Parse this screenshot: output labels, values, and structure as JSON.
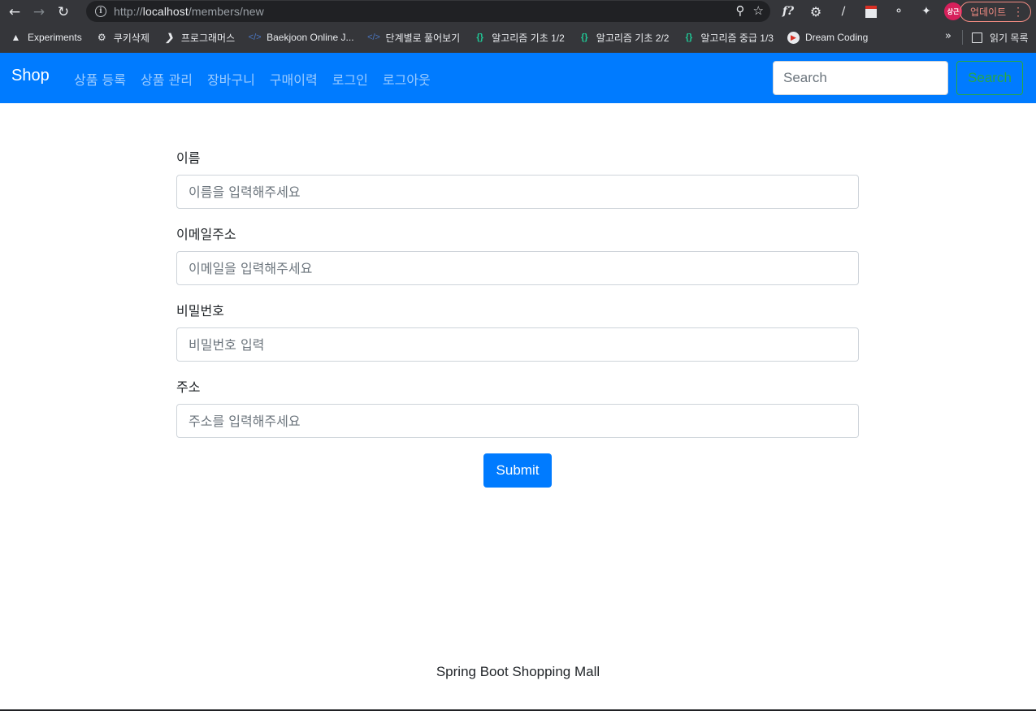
{
  "browser": {
    "url_prefix": "http://",
    "url_host": "localhost",
    "url_path": "/members/new",
    "update_label": "업데이트",
    "avatar_text": "상근",
    "bookmarks": [
      {
        "label": "Experiments",
        "icon": "flask-icon"
      },
      {
        "label": "쿠키삭제",
        "icon": "gear-icon"
      },
      {
        "label": "프로그래머스",
        "icon": "programmers-icon"
      },
      {
        "label": "Baekjoon Online J...",
        "icon": "code-icon"
      },
      {
        "label": "단계별로 풀어보기",
        "icon": "code-icon"
      },
      {
        "label": "알고리즘 기초 1/2",
        "icon": "brace-icon"
      },
      {
        "label": "알고리즘 기초 2/2",
        "icon": "brace-icon"
      },
      {
        "label": "알고리즘 중급 1/3",
        "icon": "brace-icon"
      },
      {
        "label": "Dream Coding",
        "icon": "dream-coding-icon"
      }
    ],
    "reading_list_label": "읽기 목록"
  },
  "navbar": {
    "brand": "Shop",
    "links": [
      "상품 등록",
      "상품 관리",
      "장바구니",
      "구매이력",
      "로그인",
      "로그아웃"
    ],
    "search_placeholder": "Search",
    "search_button": "Search"
  },
  "form": {
    "fields": [
      {
        "label": "이름",
        "placeholder": "이름을 입력해주세요"
      },
      {
        "label": "이메일주소",
        "placeholder": "이메일을 입력해주세요"
      },
      {
        "label": "비밀번호",
        "placeholder": "비밀번호 입력"
      },
      {
        "label": "주소",
        "placeholder": "주소를 입력해주세요"
      }
    ],
    "submit_label": "Submit"
  },
  "footer": {
    "text": "Spring Boot Shopping Mall"
  },
  "colors": {
    "primary": "#007bff",
    "success": "#28a745",
    "chrome_bg": "#35363a"
  }
}
